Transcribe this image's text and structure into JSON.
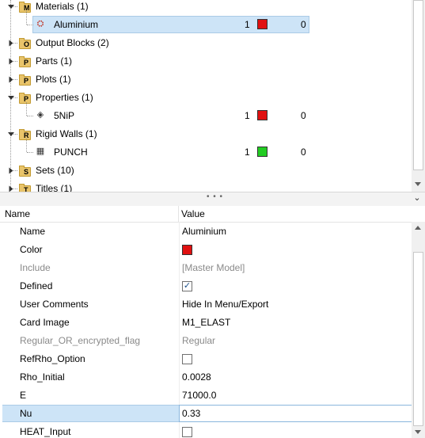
{
  "tree": {
    "items": [
      {
        "label": "Materials (1)",
        "kind": "folder",
        "glyph": "M",
        "expanded": true
      },
      {
        "label": "Aluminium",
        "kind": "child",
        "icon": "material-icon",
        "selected": true,
        "id_value": "1",
        "color": "#e01010",
        "count": "0"
      },
      {
        "label": "Output Blocks (2)",
        "kind": "folder",
        "glyph": "O",
        "expanded": false
      },
      {
        "label": "Parts (1)",
        "kind": "folder",
        "glyph": "P",
        "expanded": false
      },
      {
        "label": "Plots (1)",
        "kind": "folder",
        "glyph": "P",
        "expanded": false
      },
      {
        "label": "Properties (1)",
        "kind": "folder",
        "glyph": "P",
        "expanded": true
      },
      {
        "label": "5NiP",
        "kind": "child",
        "icon": "property-icon",
        "selected": false,
        "id_value": "1",
        "color": "#e01010",
        "count": "0"
      },
      {
        "label": "Rigid Walls (1)",
        "kind": "folder",
        "glyph": "R",
        "expanded": true
      },
      {
        "label": "PUNCH",
        "kind": "child",
        "icon": "rigid-wall-icon",
        "selected": false,
        "id_value": "1",
        "color": "#22cc22",
        "count": "0"
      },
      {
        "label": "Sets (10)",
        "kind": "folder",
        "glyph": "S",
        "expanded": false
      },
      {
        "label": "Titles (1)",
        "kind": "folder",
        "glyph": "T",
        "expanded": false
      }
    ]
  },
  "splitter": {
    "grip": "• • •",
    "collapse": "⌄"
  },
  "props": {
    "header": {
      "name": "Name",
      "value": "Value"
    },
    "rows": [
      {
        "name": "Name",
        "type": "text",
        "value": "Aluminium",
        "grey": false
      },
      {
        "name": "Color",
        "type": "swatch",
        "color": "#e01010",
        "grey": false
      },
      {
        "name": "Include",
        "type": "text",
        "value": "[Master Model]",
        "grey": true
      },
      {
        "name": "Defined",
        "type": "check",
        "checked": true,
        "grey": false
      },
      {
        "name": "User Comments",
        "type": "text",
        "value": "Hide In Menu/Export",
        "grey": false
      },
      {
        "name": "Card Image",
        "type": "text",
        "value": "M1_ELAST",
        "grey": false
      },
      {
        "name": "Regular_OR_encrypted_flag",
        "type": "text",
        "value": "Regular",
        "grey": true
      },
      {
        "name": "RefRho_Option",
        "type": "check",
        "checked": false,
        "grey": false
      },
      {
        "name": "Rho_Initial",
        "type": "text",
        "value": "0.0028",
        "grey": false
      },
      {
        "name": "E",
        "type": "text",
        "value": "71000.0",
        "grey": false
      },
      {
        "name": "Nu",
        "type": "text",
        "value": "0.33",
        "grey": false,
        "selected": true
      },
      {
        "name": "HEAT_Input",
        "type": "check",
        "checked": false,
        "grey": false
      }
    ]
  }
}
